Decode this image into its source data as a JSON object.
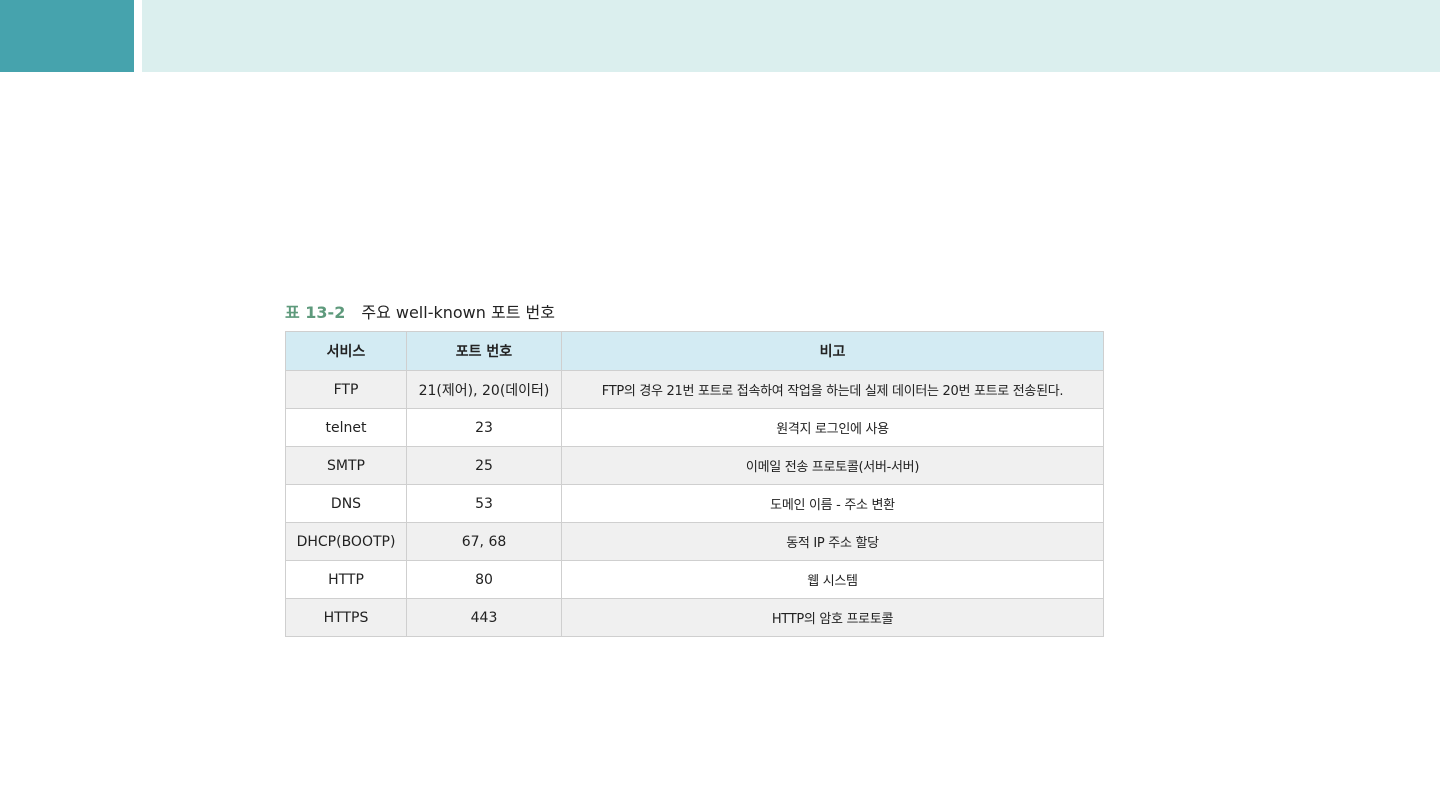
{
  "caption": {
    "label": "표 13-2",
    "title": "주요 well-known 포트 번호"
  },
  "table": {
    "headers": [
      "서비스",
      "포트 번호",
      "비고"
    ],
    "rows": [
      {
        "service": "FTP",
        "port": "21(제어), 20(데이터)",
        "note": "FTP의 경우 21번 포트로 접속하여 작업을 하는데 실제 데이터는 20번 포트로 전송된다."
      },
      {
        "service": "telnet",
        "port": "23",
        "note": "원격지 로그인에 사용"
      },
      {
        "service": "SMTP",
        "port": "25",
        "note": "이메일 전송 프로토콜(서버-서버)"
      },
      {
        "service": "DNS",
        "port": "53",
        "note": "도메인 이름 - 주소 변환"
      },
      {
        "service": "DHCP(BOOTP)",
        "port": "67, 68",
        "note": "동적 IP 주소 할당"
      },
      {
        "service": "HTTP",
        "port": "80",
        "note": "웹 시스템"
      },
      {
        "service": "HTTPS",
        "port": "443",
        "note": "HTTP의 암호 프로토콜"
      }
    ]
  },
  "colors": {
    "accent": "#46a3ad",
    "header_band": "#dbefee",
    "table_header": "#d3ebf3",
    "caption_label": "#5e9a7c"
  }
}
